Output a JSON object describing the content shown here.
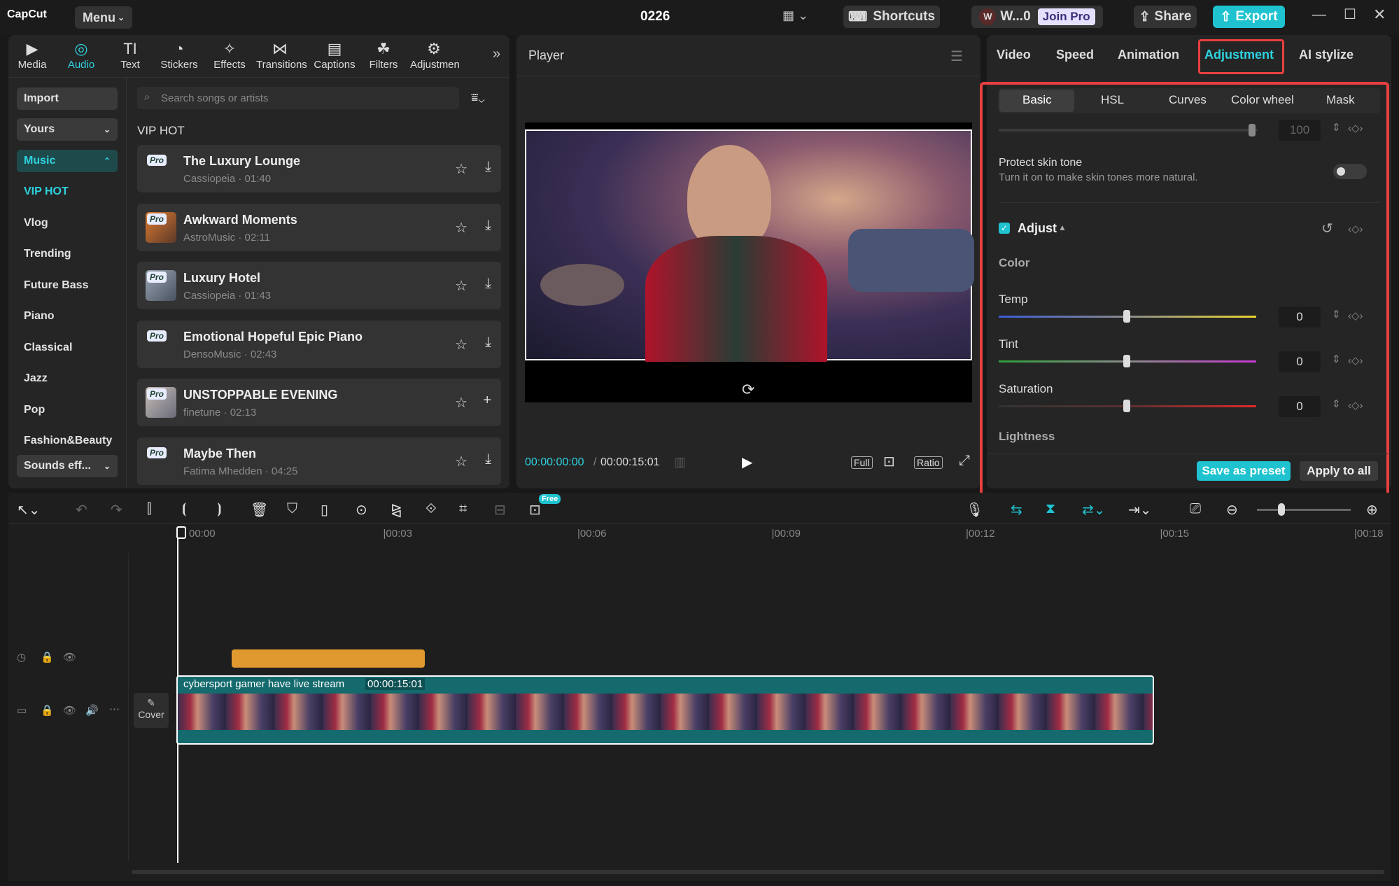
{
  "app": {
    "logo": "CapCut",
    "menu": "Menu",
    "project": "0226",
    "shortcuts": "Shortcuts",
    "user": "W...0",
    "join_pro": "Join Pro",
    "share": "Share",
    "export": "Export"
  },
  "toolbar": {
    "tools": [
      {
        "label": "Media",
        "icon": "media-icon"
      },
      {
        "label": "Audio",
        "icon": "audio-icon"
      },
      {
        "label": "Text",
        "icon": "text-icon"
      },
      {
        "label": "Stickers",
        "icon": "stickers-icon"
      },
      {
        "label": "Effects",
        "icon": "effects-icon"
      },
      {
        "label": "Transitions",
        "icon": "transitions-icon"
      },
      {
        "label": "Captions",
        "icon": "captions-icon"
      },
      {
        "label": "Filters",
        "icon": "filters-icon"
      },
      {
        "label": "Adjustmen",
        "icon": "adjustment-icon"
      }
    ]
  },
  "sidebar": {
    "import": "Import",
    "yours": "Yours",
    "music": "Music",
    "items": [
      "VIP HOT",
      "Vlog",
      "Trending",
      "Future Bass",
      "Piano",
      "Classical",
      "Jazz",
      "Pop",
      "Fashion&Beauty"
    ],
    "sounds": "Sounds eff..."
  },
  "library": {
    "search_placeholder": "Search songs or artists",
    "section": "VIP HOT",
    "pro_badge": "Pro",
    "tracks": [
      {
        "title": "The Luxury Lounge",
        "meta": "Cassiopeia · 01:40"
      },
      {
        "title": "Awkward Moments",
        "meta": "AstroMusic · 02:11"
      },
      {
        "title": "Luxury Hotel",
        "meta": "Cassiopeia · 01:43"
      },
      {
        "title": "Emotional Hopeful Epic Piano",
        "meta": "DensoMusic · 02:43"
      },
      {
        "title": "UNSTOPPABLE EVENING",
        "meta": "finetune · 02:13"
      },
      {
        "title": "Maybe Then",
        "meta": "Fatima Mhedden · 04:25"
      }
    ]
  },
  "player": {
    "title": "Player",
    "current": "00:00:00:00",
    "duration": "00:00:15:01",
    "full": "Full",
    "ratio": "Ratio"
  },
  "inspector": {
    "tabs": [
      "Video",
      "Speed",
      "Animation",
      "Adjustment",
      "AI stylize"
    ],
    "subtabs": [
      "Basic",
      "HSL",
      "Curves",
      "Color wheel",
      "Mask"
    ],
    "top_value": "100",
    "protect_title": "Protect skin tone",
    "protect_desc": "Turn it on to make skin tones more natural.",
    "adjust": "Adjust",
    "color": "Color",
    "sliders": [
      {
        "label": "Temp",
        "value": "0"
      },
      {
        "label": "Tint",
        "value": "0"
      },
      {
        "label": "Saturation",
        "value": "0"
      }
    ],
    "lightness": "Lightness",
    "save_preset": "Save as preset",
    "apply_all": "Apply to all"
  },
  "timeline": {
    "free_badge": "Free",
    "ticks": [
      "00:00",
      "|00:03",
      "|00:06",
      "|00:09",
      "|00:12",
      "|00:15",
      "|00:18"
    ],
    "clip_name": "cybersport gamer have live stream",
    "clip_duration": "00:00:15:01",
    "cover": "Cover"
  }
}
